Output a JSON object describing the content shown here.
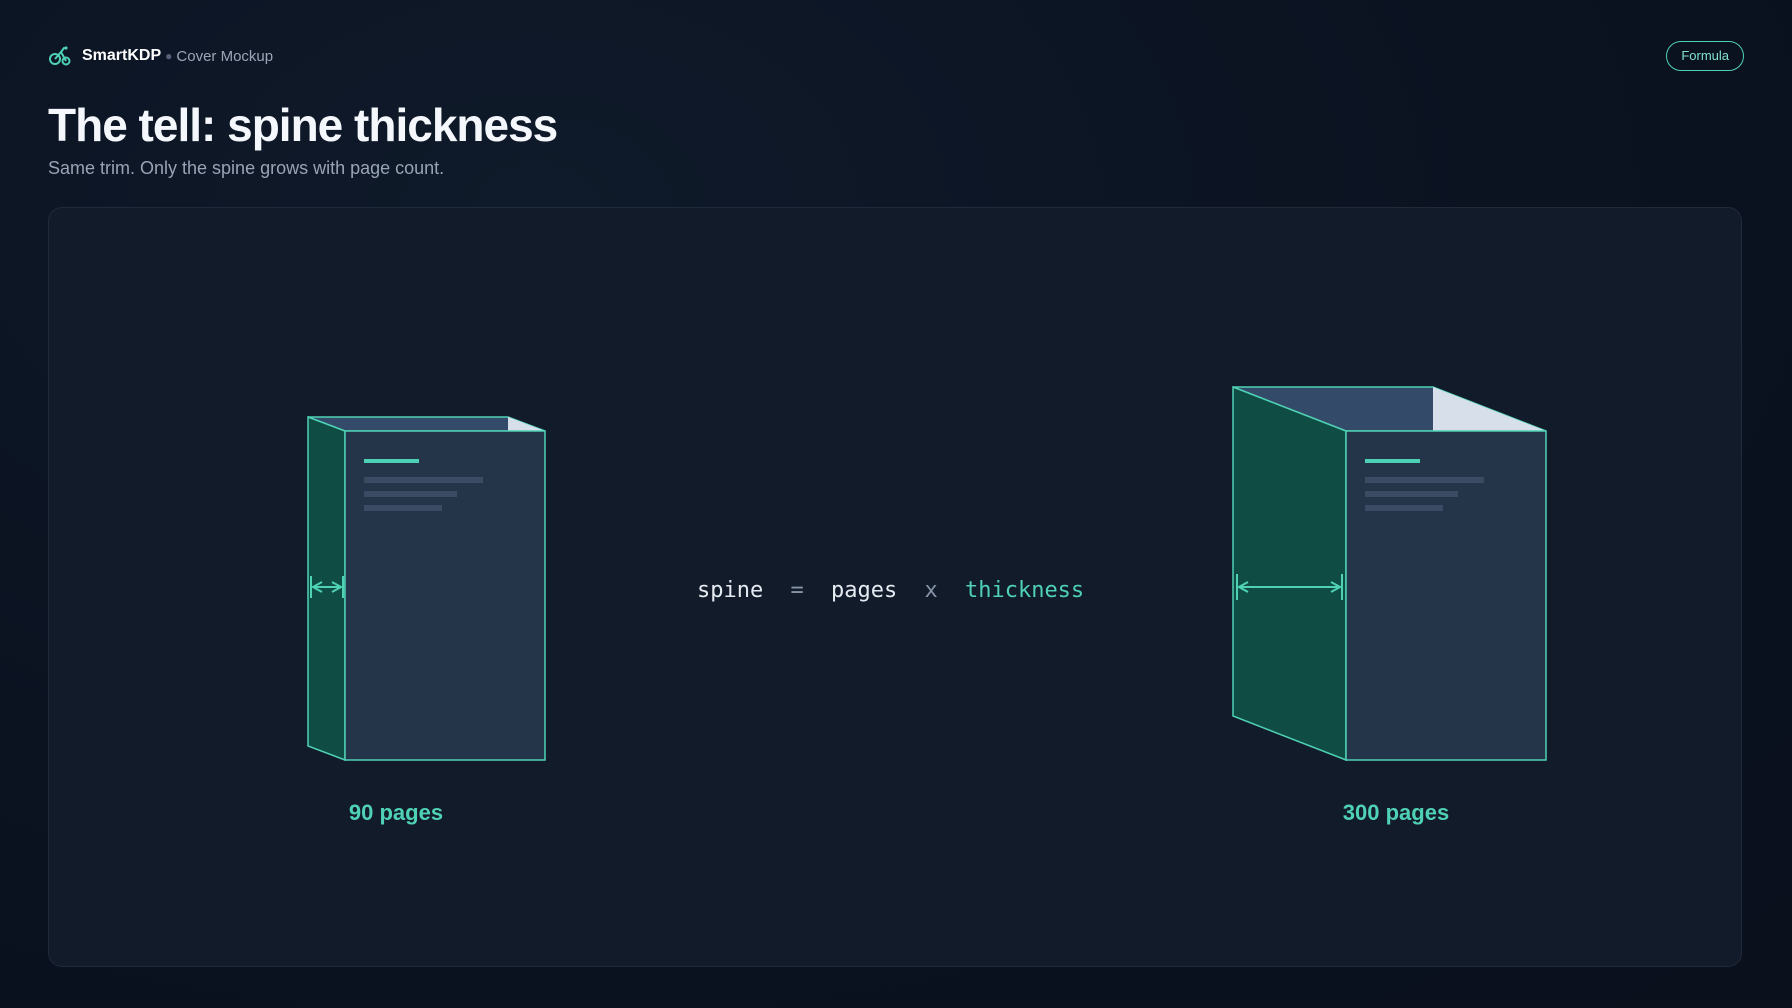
{
  "header": {
    "brand": "SmartKDP",
    "breadcrumb": "Cover Mockup",
    "badge": "Formula"
  },
  "page": {
    "title": "The tell: spine thickness",
    "subtitle": "Same trim. Only the spine grows with page count."
  },
  "diagram": {
    "books": [
      {
        "label": "90 pages",
        "pages": 90
      },
      {
        "label": "300 pages",
        "pages": 300
      }
    ],
    "formula": {
      "lhs": "spine",
      "equals": "=",
      "term1": "pages",
      "times": "x",
      "term2": "thickness"
    },
    "colors": {
      "accent": "#4fd1b5",
      "spine_fill": "#0f4c44",
      "cover_fill": "#243449",
      "top_fill": "#334a68",
      "page_fill": "#d6dfea",
      "placeholder_lines": "#3b4b63"
    }
  }
}
